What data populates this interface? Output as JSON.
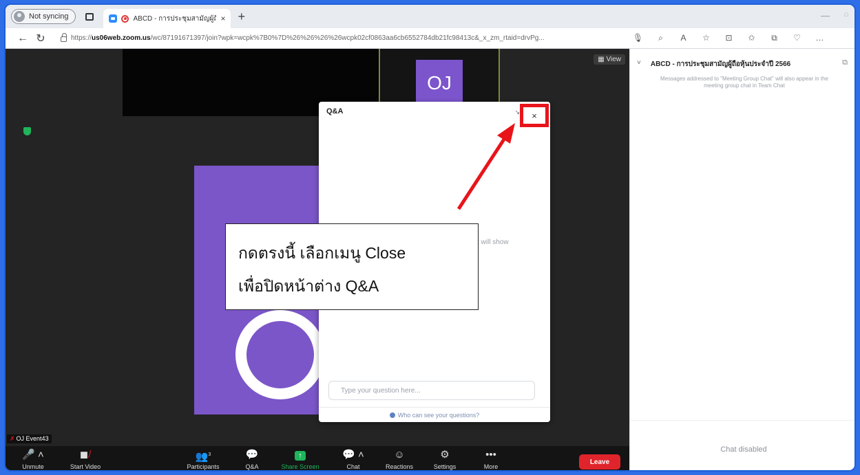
{
  "browser": {
    "profile_label": "Not syncing",
    "tab_title": "ABCD - การประชุมสามัญผู้ถือหุ้...",
    "tab_close": "×",
    "new_tab": "+",
    "url_prefix": "https://",
    "url_host": "us06web.zoom.us",
    "url_rest": "/wc/87191671397/join?wpk=wcpk%7B0%7D%26%26%26%26wcpk02cf0863aa6cb6552784db21fc98413c&_x_zm_rtaid=drvPg...",
    "addr_icons": [
      "🎙",
      "⌕",
      "A",
      "☆",
      "⊡",
      "✩",
      "⧉",
      "♡",
      "…"
    ]
  },
  "meeting": {
    "oj_initials": "OJ",
    "view_label": "View",
    "participant_name": "OJ Event43",
    "qa": {
      "title": "Q&A",
      "minimize": "↘",
      "close": "×",
      "empty_text": "st will show",
      "input_placeholder": "Type your question here...",
      "who_label": "Who can see your questions?"
    },
    "callout": {
      "line1": "กดตรงนี้ เลือกเมนู Close",
      "line2": "เพื่อปิดหน้าต่าง Q&A"
    },
    "toolbar": [
      {
        "label": "Unmute",
        "glyph": "🎤"
      },
      {
        "label": "Start Video",
        "glyph": "◼"
      },
      {
        "label": "Participants",
        "glyph": "👥",
        "count": "3"
      },
      {
        "label": "Q&A",
        "glyph": "💬"
      },
      {
        "label": "Share Screen",
        "glyph": "↑"
      },
      {
        "label": "Chat",
        "glyph": "💬"
      },
      {
        "label": "Reactions",
        "glyph": "☺"
      },
      {
        "label": "Settings",
        "glyph": "⚙"
      },
      {
        "label": "More",
        "glyph": "•••"
      }
    ],
    "leave_label": "Leave"
  },
  "chat": {
    "title": "ABCD - การประชุมสามัญผู้ถือหุ้นประจำปี 2566",
    "note": "Messages addressed to \"Meeting Group Chat\" will also appear in the meeting group chat in Team Chat",
    "disabled": "Chat disabled"
  },
  "colors": {
    "zoom_purple": "#7b56c8",
    "highlight_red": "#e8141a",
    "leave_red": "#e0242b",
    "share_green": "#1fb55a"
  }
}
